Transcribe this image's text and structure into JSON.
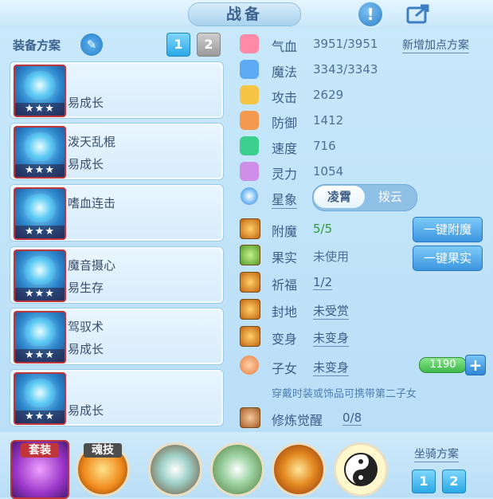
{
  "header": {
    "title": "战备",
    "help_icon": "exclamation-icon",
    "share_icon": "share-icon"
  },
  "equip_scheme": {
    "label": "装备方案",
    "tabs": [
      "1",
      "2"
    ],
    "selected_tab": "1",
    "items": [
      {
        "name": "",
        "desc": "易成长",
        "stars": "★★★"
      },
      {
        "name": "泼天乱棍",
        "desc": "易成长",
        "stars": "★★★"
      },
      {
        "name": "嗜血连击",
        "desc": "",
        "stars": "★★★"
      },
      {
        "name": "魔音摄心",
        "desc": "易生存",
        "stars": "★★★"
      },
      {
        "name": "驾驭术",
        "desc": "易成长",
        "stars": "★★★"
      },
      {
        "name": "",
        "desc": "易成长",
        "stars": "★★★"
      }
    ]
  },
  "stats": {
    "add_points_link": "新增加点方案",
    "items": [
      {
        "label": "气血",
        "value": "3951/3951",
        "icon": "heart-icon",
        "color": "#ff8aa6"
      },
      {
        "label": "魔法",
        "value": "3343/3343",
        "icon": "mana-icon",
        "color": "#5da9f4"
      },
      {
        "label": "攻击",
        "value": "2629",
        "icon": "sword-icon",
        "color": "#f7c545"
      },
      {
        "label": "防御",
        "value": "1412",
        "icon": "shield-icon",
        "color": "#f39a4e"
      },
      {
        "label": "速度",
        "value": "716",
        "icon": "speed-icon",
        "color": "#3ccf8e"
      },
      {
        "label": "灵力",
        "value": "1054",
        "icon": "spirit-icon",
        "color": "#cf8ee8"
      }
    ]
  },
  "constellation": {
    "label": "星象",
    "options": [
      "凌霄",
      "拨云"
    ],
    "selected": "凌霄"
  },
  "features": {
    "enchant": {
      "label": "附魔",
      "value": "5/5",
      "button": "一键附魔"
    },
    "fruit": {
      "label": "果实",
      "value": "未使用",
      "button": "一键果实"
    },
    "blessing": {
      "label": "祈福",
      "value": "1/2"
    },
    "fief": {
      "label": "封地",
      "value": "未受赏"
    },
    "transform": {
      "label": "变身",
      "value": "未变身"
    },
    "child": {
      "label": "子女",
      "value": "未变身",
      "bar_value": "1190",
      "hint": "穿戴时装或饰品可携带第二子女"
    },
    "awaken": {
      "label": "修炼觉醒",
      "value": "0/8"
    }
  },
  "bottom": {
    "set_label": "套装",
    "soul_skill_label": "魂技",
    "mount_scheme_label": "坐骑方案",
    "mount_tabs": [
      "1",
      "2"
    ]
  }
}
